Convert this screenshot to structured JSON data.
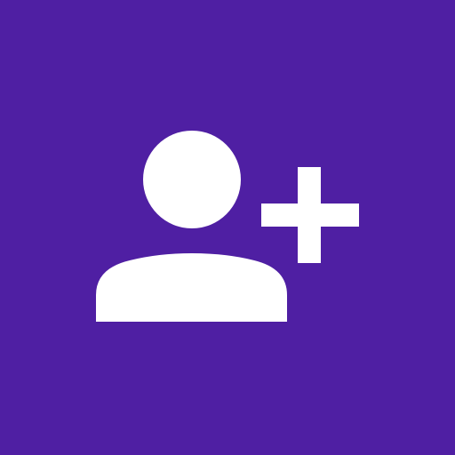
{
  "icon": {
    "name": "add-user-icon",
    "background_color": "#4f1fa3",
    "foreground_color": "#ffffff",
    "parts": [
      "person-head",
      "person-body",
      "plus-sign"
    ]
  }
}
